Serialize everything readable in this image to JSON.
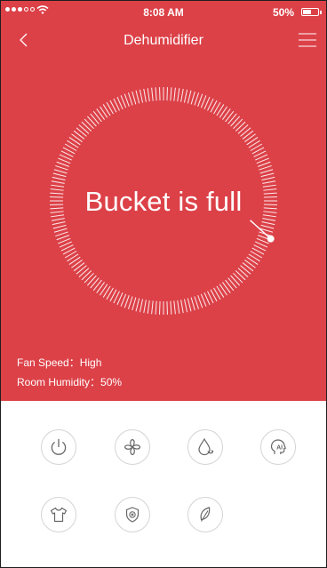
{
  "status_bar": {
    "time": "8:08 AM",
    "battery": "50%",
    "battery_level": 0.5,
    "signal_bars": 5,
    "signal_filled": 3
  },
  "header": {
    "title": "Dehumidifier",
    "back_icon": "chevron-left-icon",
    "menu_icon": "hamburger-menu-icon"
  },
  "dial": {
    "message": "Bucket is full",
    "indicator_fraction": 0.88
  },
  "info": {
    "fan_speed": "Fan Speed：High",
    "room_humidity": "Room Humidity：50%"
  },
  "modes": [
    {
      "name": "power-button",
      "icon": "power-icon"
    },
    {
      "name": "fan-speed-button",
      "icon": "fan-icon"
    },
    {
      "name": "dehumidify-mode-button",
      "icon": "water-drop-icon"
    },
    {
      "name": "ai-mode-button",
      "icon": "ai-head-icon"
    },
    {
      "name": "dry-clothes-button",
      "icon": "shirt-icon"
    },
    {
      "name": "anti-mildew-button",
      "icon": "shield-x-icon"
    },
    {
      "name": "eco-mode-button",
      "icon": "leaf-icon"
    }
  ],
  "colors": {
    "primary": "#dc4148",
    "icon": "#666666",
    "button_border": "#d4d4d4"
  }
}
